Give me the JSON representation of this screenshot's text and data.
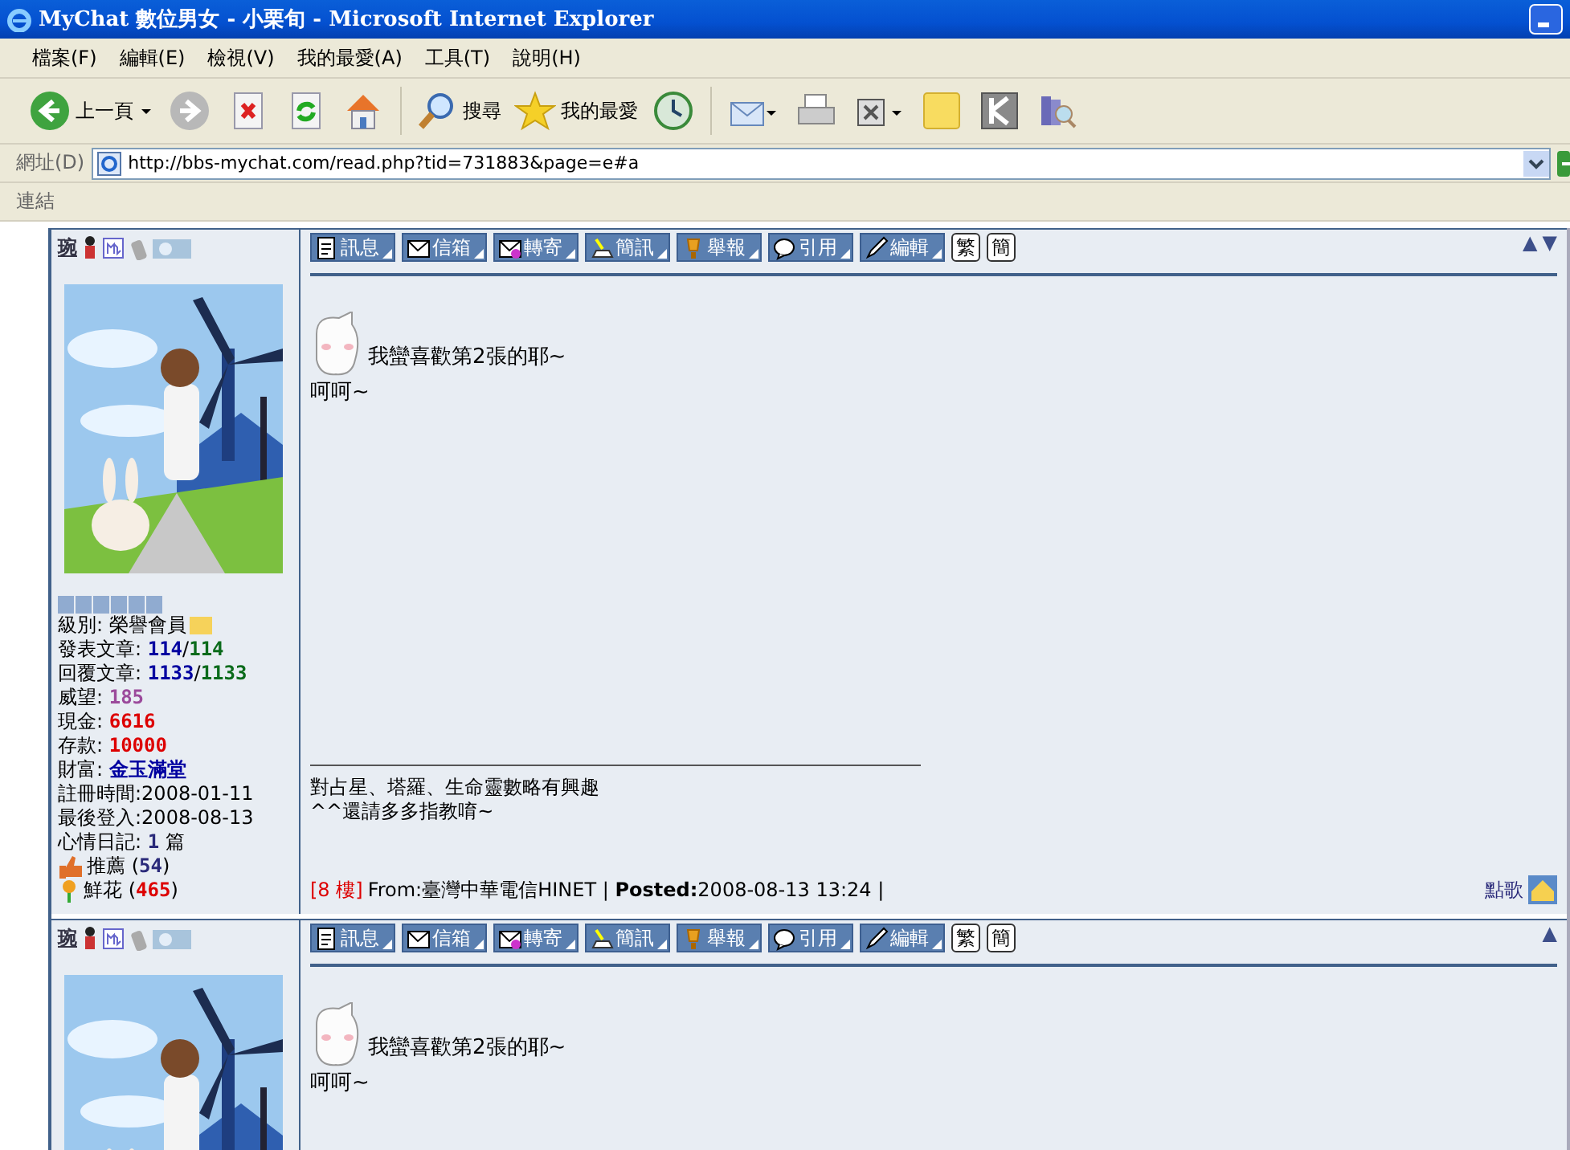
{
  "window": {
    "title": "MyChat 數位男女 - 小栗旬 - Microsoft Internet Explorer"
  },
  "menu": [
    "檔案(F)",
    "編輯(E)",
    "檢視(V)",
    "我的最愛(A)",
    "工具(T)",
    "說明(H)"
  ],
  "toolbar": [
    {
      "kind": "back",
      "label": "上一頁"
    },
    {
      "kind": "forward"
    },
    {
      "kind": "stop"
    },
    {
      "kind": "refresh"
    },
    {
      "kind": "home"
    },
    {
      "kind": "sep"
    },
    {
      "kind": "search",
      "label": "搜尋"
    },
    {
      "kind": "favorites",
      "label": "我的最愛"
    },
    {
      "kind": "history"
    },
    {
      "kind": "sep"
    },
    {
      "kind": "mail"
    },
    {
      "kind": "print"
    },
    {
      "kind": "edit"
    },
    {
      "kind": "note"
    },
    {
      "kind": "k"
    },
    {
      "kind": "research"
    }
  ],
  "address": {
    "label": "網址(D)",
    "url": "http://bbs-mychat.com/read.php?tid=731883&page=e#a"
  },
  "links_bar": {
    "label": "連結"
  },
  "posts": [
    {
      "author": "琬",
      "arrows": [
        "▲",
        "▼"
      ],
      "actions": [
        {
          "kind": "page",
          "label": "訊息"
        },
        {
          "kind": "mail",
          "label": "信箱"
        },
        {
          "kind": "forward",
          "label": "轉寄"
        },
        {
          "kind": "sms",
          "label": "簡訊"
        },
        {
          "kind": "report",
          "label": "舉報"
        },
        {
          "kind": "quote",
          "label": "引用"
        },
        {
          "kind": "edit",
          "label": "編輯"
        },
        {
          "kind": "plain",
          "label": "繁"
        },
        {
          "kind": "plain",
          "label": "簡"
        }
      ],
      "stats": [
        {
          "kind": "level",
          "parts": [
            {
              "kind": "plain",
              "text": "級別: 榮譽會員"
            }
          ]
        },
        {
          "kind": "text",
          "parts": [
            {
              "kind": "plain",
              "text": "發表文章: "
            },
            {
              "kind": "blue",
              "text": "114"
            },
            {
              "kind": "plain",
              "text": "/"
            },
            {
              "kind": "green",
              "text": "114"
            }
          ]
        },
        {
          "kind": "text",
          "parts": [
            {
              "kind": "plain",
              "text": "回覆文章: "
            },
            {
              "kind": "blue",
              "text": "1133"
            },
            {
              "kind": "plain",
              "text": "/"
            },
            {
              "kind": "green",
              "text": "1133"
            }
          ]
        },
        {
          "kind": "text",
          "parts": [
            {
              "kind": "plain",
              "text": "威望: "
            },
            {
              "kind": "purple",
              "text": "185"
            }
          ]
        },
        {
          "kind": "text",
          "parts": [
            {
              "kind": "plain",
              "text": "現金: "
            },
            {
              "kind": "red",
              "text": "6616"
            }
          ]
        },
        {
          "kind": "text",
          "parts": [
            {
              "kind": "plain",
              "text": "存款: "
            },
            {
              "kind": "red",
              "text": "10000"
            }
          ]
        },
        {
          "kind": "text",
          "parts": [
            {
              "kind": "plain",
              "text": "財富: "
            },
            {
              "kind": "blue",
              "text": "金玉滿堂"
            }
          ]
        },
        {
          "kind": "text",
          "parts": [
            {
              "kind": "plain",
              "text": "註冊時間:2008-01-11"
            }
          ]
        },
        {
          "kind": "text",
          "parts": [
            {
              "kind": "plain",
              "text": "最後登入:2008-08-13"
            }
          ]
        },
        {
          "kind": "text",
          "parts": [
            {
              "kind": "plain",
              "text": "心情日記: "
            },
            {
              "kind": "navy",
              "text": "1"
            },
            {
              "kind": "plain",
              "text": " 篇"
            }
          ]
        },
        {
          "kind": "thumb",
          "parts": [
            {
              "kind": "plain",
              "text": "推薦 ("
            },
            {
              "kind": "navy",
              "text": "54"
            },
            {
              "kind": "plain",
              "text": ")"
            }
          ]
        },
        {
          "kind": "flower",
          "parts": [
            {
              "kind": "plain",
              "text": "鮮花 ("
            },
            {
              "kind": "red",
              "text": "465"
            },
            {
              "kind": "plain",
              "text": ")"
            }
          ]
        }
      ],
      "message": [
        "我蠻喜歡第2張的耶~",
        "呵呵~"
      ],
      "signature": [
        "對占星、塔羅、生命靈數略有興趣",
        "^^還請多多指教唷~"
      ],
      "footer": {
        "floor": "[8 樓]",
        "info": "From:臺灣中華電信HINET | **Posted:**2008-08-13 13:24 |",
        "song": "點歌"
      }
    },
    {
      "author": "琬",
      "arrows": [
        "▲"
      ],
      "actions": [
        {
          "kind": "page",
          "label": "訊息"
        },
        {
          "kind": "mail",
          "label": "信箱"
        },
        {
          "kind": "forward",
          "label": "轉寄"
        },
        {
          "kind": "sms",
          "label": "簡訊"
        },
        {
          "kind": "report",
          "label": "舉報"
        },
        {
          "kind": "quote",
          "label": "引用"
        },
        {
          "kind": "edit",
          "label": "編輯"
        },
        {
          "kind": "plain",
          "label": "繁"
        },
        {
          "kind": "plain",
          "label": "簡"
        }
      ],
      "message": [
        "我蠻喜歡第2張的耶~",
        "呵呵~"
      ]
    }
  ]
}
